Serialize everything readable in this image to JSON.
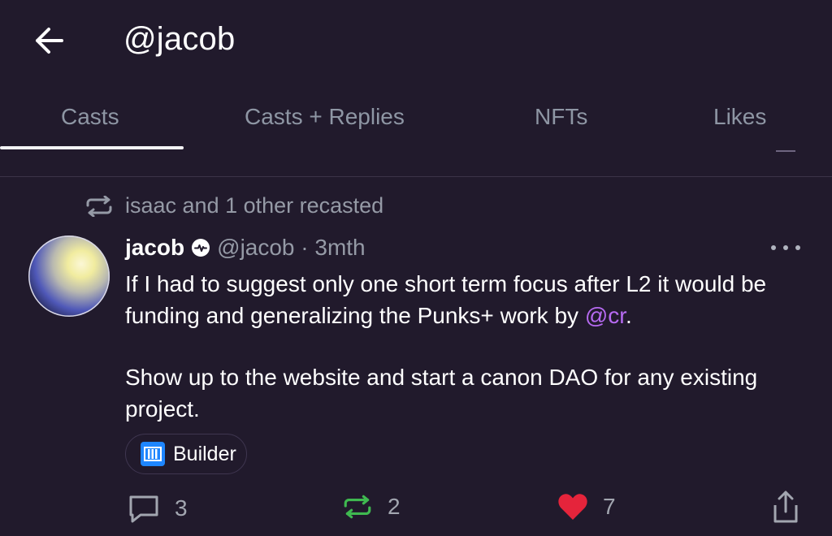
{
  "header": {
    "title": "@jacob",
    "back_icon": "arrow-left-icon"
  },
  "tabs": [
    {
      "label": "Casts",
      "active": true
    },
    {
      "label": "Casts + Replies",
      "active": false
    },
    {
      "label": "NFTs",
      "active": false
    },
    {
      "label": "Likes",
      "active": false
    }
  ],
  "recast": {
    "icon": "recast-icon",
    "text": "isaac and 1 other recasted"
  },
  "post": {
    "author": "jacob",
    "verified_icon": "verified-badge-icon",
    "handle": "@jacob · 3mth",
    "line1": "If I had to suggest only one short term focus after L2 it would be funding and generalizing the Punks+ work by ",
    "mention": "@cr",
    "line1_end": ".",
    "paragraph2": "Show up to the website and start a canon DAO for any existing project.",
    "channel": {
      "label": "Builder",
      "icon": "builder-channel-icon",
      "color": "#1e86ff"
    },
    "actions": {
      "replies": {
        "count": "3",
        "icon": "comment-icon"
      },
      "recasts": {
        "count": "2",
        "icon": "recast-icon",
        "color": "#3fb950"
      },
      "likes": {
        "count": "7",
        "icon": "heart-icon",
        "color": "#e5243b"
      },
      "share_icon": "share-icon"
    }
  },
  "colors": {
    "background": "#211a2c",
    "muted": "#959aa6",
    "mention": "#b66af1"
  }
}
